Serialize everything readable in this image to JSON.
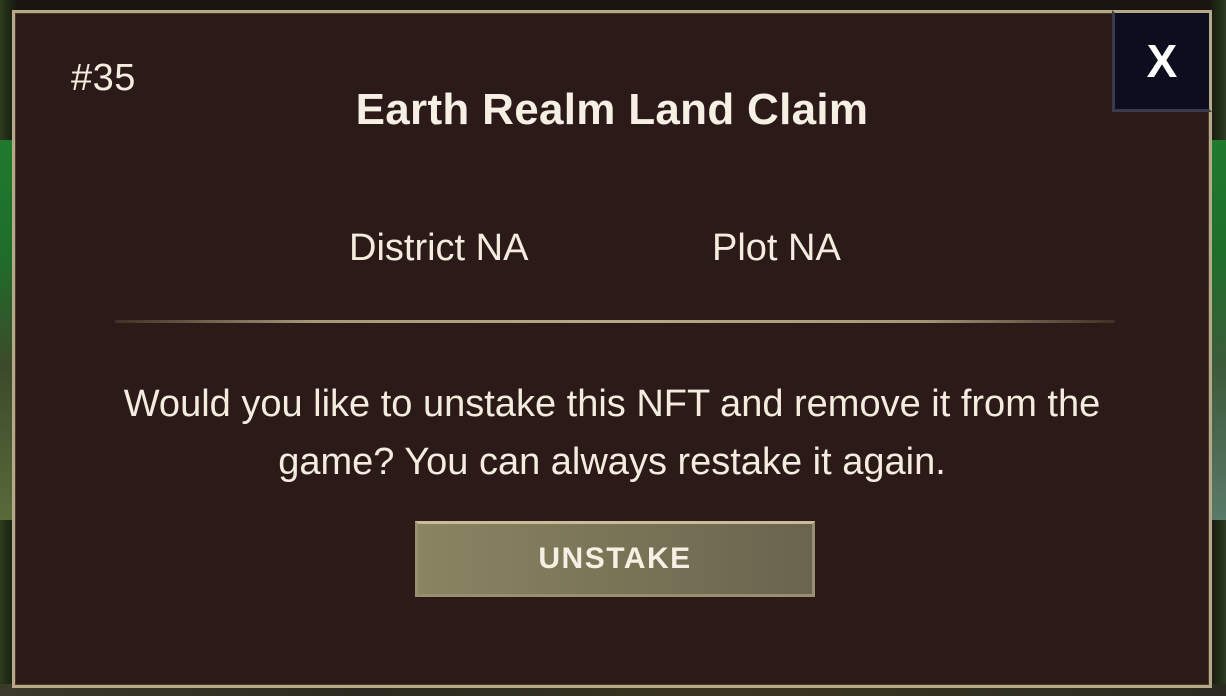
{
  "modal": {
    "token_id": "#35",
    "title": "Earth Realm Land Claim",
    "district": "District NA",
    "plot": "Plot NA",
    "message": "Would you like to unstake this NFT and remove it from the game? You can always restake it again.",
    "unstake_label": "UNSTAKE",
    "close_label": "X"
  },
  "colors": {
    "modal_bg": "#2b1a18",
    "border_gold": "#b8a88a",
    "close_bg": "#0c0d1e",
    "button_bg": "#7a7457",
    "text": "#f3ecdf"
  },
  "icons": {
    "close": "close-icon"
  }
}
